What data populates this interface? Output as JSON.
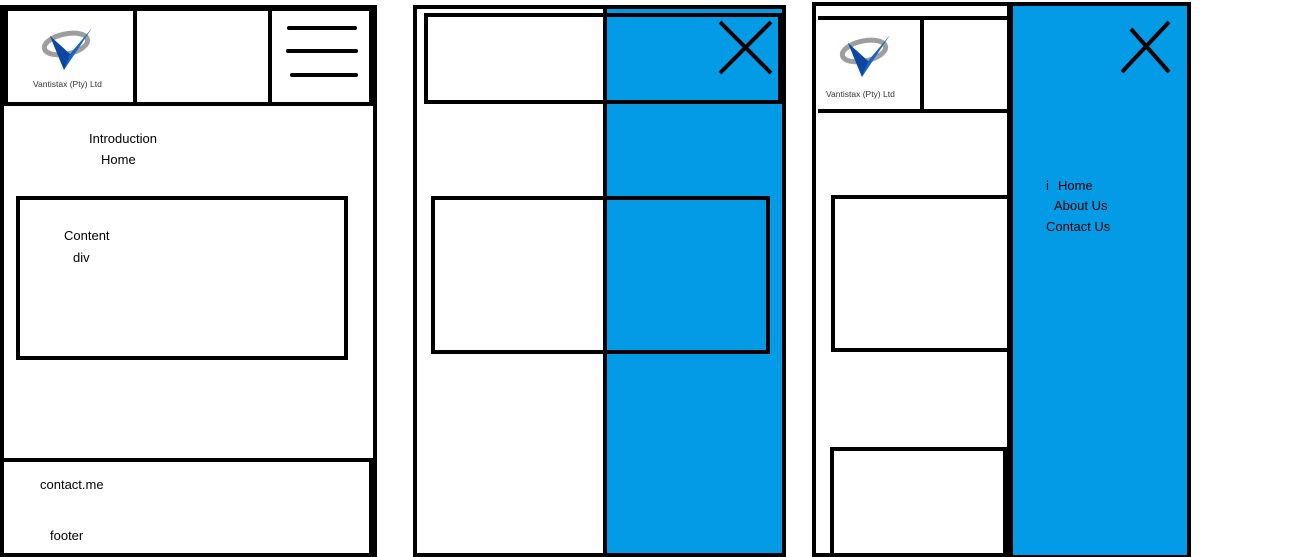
{
  "colors": {
    "accent": "#039be5",
    "stroke": "#000000",
    "background": "#ffffff"
  },
  "logo": {
    "text": "Vantistax (Pty) Ltd"
  },
  "frame1": {
    "nav_intro": "Introduction",
    "nav_home": "Home",
    "content_line1": "Content",
    "content_line2": "div",
    "footer_contact": "contact.me",
    "footer_label": "footer"
  },
  "frame3": {
    "menu_marker": "i",
    "menu_items": [
      "Home",
      "About Us",
      "Contact Us"
    ]
  },
  "icons": {
    "hamburger": "hamburger-icon",
    "close": "close-icon",
    "logo": "checkmark-logo-icon"
  }
}
